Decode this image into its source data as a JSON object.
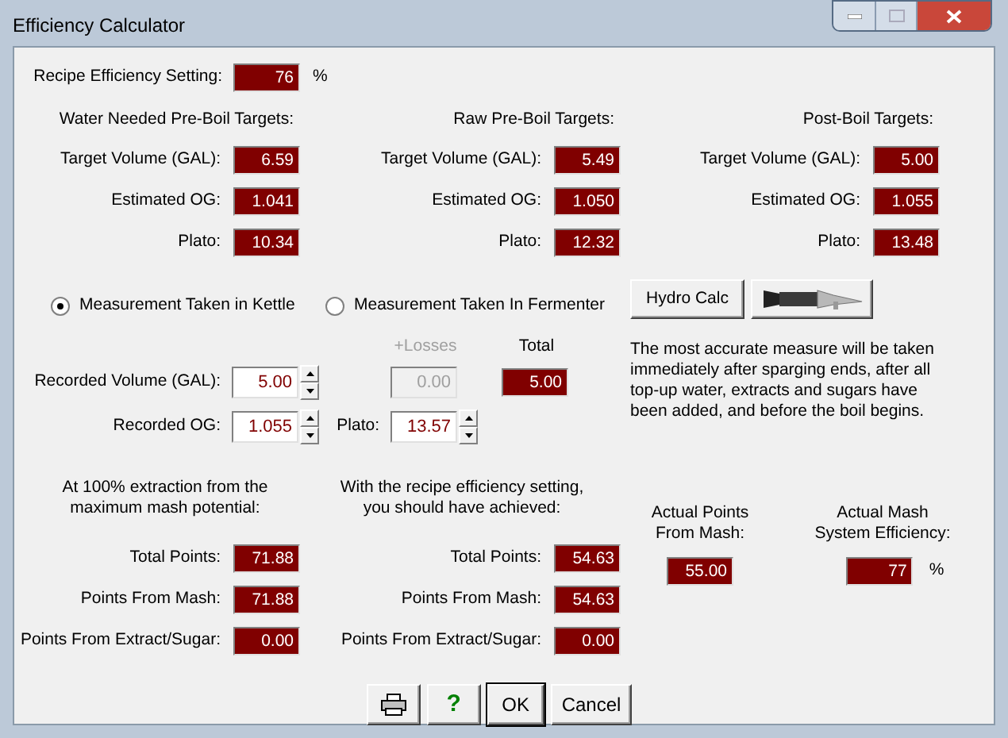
{
  "window": {
    "title": "Efficiency Calculator"
  },
  "recipe_efficiency": {
    "label": "Recipe Efficiency Setting:",
    "value": "76",
    "unit": "%"
  },
  "target_groups": [
    {
      "title": "Water Needed Pre-Boil Targets:",
      "rows": [
        {
          "label": "Target Volume (GAL):",
          "value": "6.59"
        },
        {
          "label": "Estimated OG:",
          "value": "1.041"
        },
        {
          "label": "Plato:",
          "value": "10.34"
        }
      ]
    },
    {
      "title": "Raw Pre-Boil Targets:",
      "rows": [
        {
          "label": "Target Volume (GAL):",
          "value": "5.49"
        },
        {
          "label": "Estimated OG:",
          "value": "1.050"
        },
        {
          "label": "Plato:",
          "value": "12.32"
        }
      ]
    },
    {
      "title": "Post-Boil Targets:",
      "rows": [
        {
          "label": "Target Volume (GAL):",
          "value": "5.00"
        },
        {
          "label": "Estimated OG:",
          "value": "1.055"
        },
        {
          "label": "Plato:",
          "value": "13.48"
        }
      ]
    }
  ],
  "measurement_options": [
    {
      "label": "Measurement Taken in Kettle",
      "selected": true
    },
    {
      "label": "Measurement Taken In Fermenter",
      "selected": false
    }
  ],
  "recorded_volume": {
    "label": "Recorded Volume (GAL):",
    "value": "5.00"
  },
  "losses": {
    "label": "+Losses",
    "value": "0.00",
    "disabled": true
  },
  "total": {
    "label": "Total",
    "value": "5.00"
  },
  "recorded_og": {
    "label": "Recorded OG:",
    "value": "1.055"
  },
  "plato": {
    "label": "Plato:",
    "value": "13.57"
  },
  "hydro_calc_button": {
    "label": "Hydro Calc"
  },
  "note_lines": [
    "The most accurate measure will be taken",
    "immediately after sparging ends, after all",
    "top-up water, extracts and sugars have",
    "been added, and before the boil begins."
  ],
  "extraction_groups": [
    {
      "title_lines": [
        "At 100% extraction from the",
        "maximum mash potential:"
      ],
      "rows": [
        {
          "label": "Total Points:",
          "value": "71.88"
        },
        {
          "label": "Points From Mash:",
          "value": "71.88"
        },
        {
          "label": "Points From Extract/Sugar:",
          "value": "0.00"
        }
      ]
    },
    {
      "title_lines": [
        "With the recipe efficiency setting,",
        "you should have achieved:"
      ],
      "rows": [
        {
          "label": "Total Points:",
          "value": "54.63"
        },
        {
          "label": "Points From Mash:",
          "value": "54.63"
        },
        {
          "label": "Points From Extract/Sugar:",
          "value": "0.00"
        }
      ]
    }
  ],
  "actual_points": {
    "label_lines": [
      "Actual Points",
      "From Mash:"
    ],
    "value": "55.00"
  },
  "actual_efficiency": {
    "label_lines": [
      "Actual Mash",
      "System Efficiency:"
    ],
    "value": "77",
    "unit": "%"
  },
  "buttons": [
    {
      "kind": "print"
    },
    {
      "kind": "help",
      "label": "?"
    },
    {
      "kind": "text",
      "label": "OK",
      "default": true
    },
    {
      "kind": "text",
      "label": "Cancel",
      "default": false
    }
  ]
}
